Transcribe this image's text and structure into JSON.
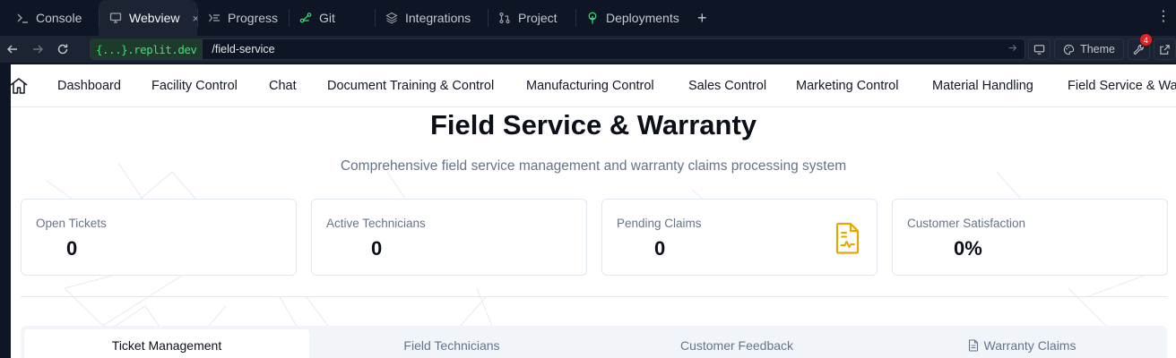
{
  "tabs": [
    {
      "label": "Console",
      "icon": "terminal-icon"
    },
    {
      "label": "Webview",
      "icon": "monitor-icon",
      "active": true
    },
    {
      "label": "Progress",
      "icon": "progress-icon"
    },
    {
      "label": "Git",
      "icon": "git-branch-icon"
    },
    {
      "label": "Integrations",
      "icon": "layers-icon"
    },
    {
      "label": "Project",
      "icon": "pull-request-icon"
    },
    {
      "label": "Deployments",
      "icon": "deploy-tree-icon"
    }
  ],
  "tab_close": "×",
  "tab_add": "+",
  "tab_menu": "⋮",
  "url": {
    "host": "{...}.replit.dev",
    "path": "/field-service",
    "theme_label": "Theme",
    "tools_badge": "4"
  },
  "appnav": {
    "items": [
      "Dashboard",
      "Facility Control",
      "Chat",
      "Document Training & Control",
      "Manufacturing Control",
      "Sales Control",
      "Marketing Control",
      "Material Handling",
      "Field Service & Warranty"
    ]
  },
  "page": {
    "title": "Field Service & Warranty",
    "subtitle": "Comprehensive field service management and warranty claims processing system"
  },
  "stats": [
    {
      "label": "Open Tickets",
      "value": "0"
    },
    {
      "label": "Active Technicians",
      "value": "0"
    },
    {
      "label": "Pending Claims",
      "value": "0",
      "icon": "file-chart-icon"
    },
    {
      "label": "Customer Satisfaction",
      "value": "0%"
    }
  ],
  "content_tabs": [
    {
      "label": "Ticket Management",
      "active": true
    },
    {
      "label": "Field Technicians"
    },
    {
      "label": "Customer Feedback"
    },
    {
      "label": "Warranty Claims",
      "icon": "file-icon"
    }
  ],
  "colors": {
    "ide_bg": "#0e1525",
    "ide_panel": "#1c2333",
    "url_host": "#3ee07a",
    "claims_icon": "#e6a700",
    "badge": "#e52222"
  }
}
